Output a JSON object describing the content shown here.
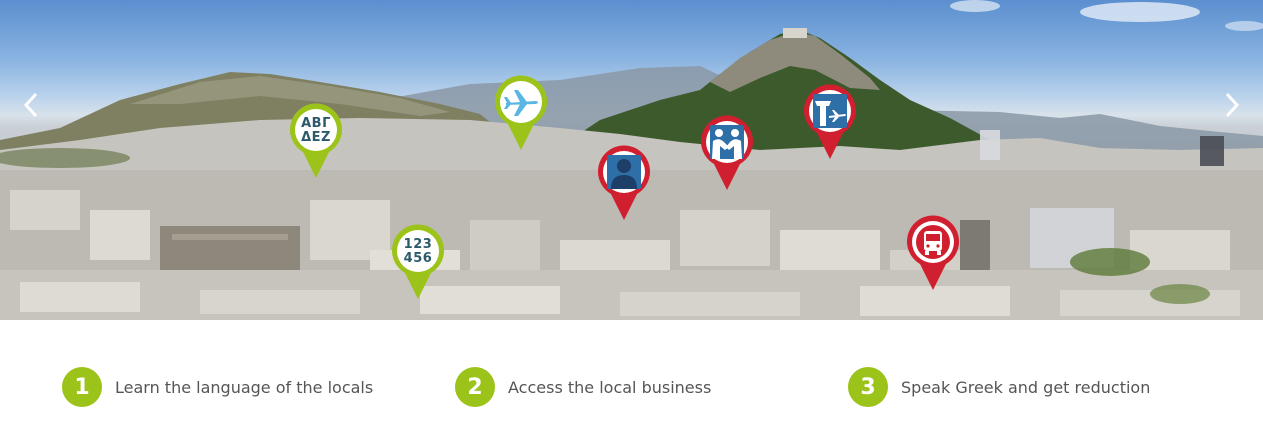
{
  "slider": {
    "prev_icon": "chevron-left-icon",
    "next_icon": "chevron-right-icon",
    "pins": [
      {
        "name": "greek-alphabet",
        "color": "#9cc31a",
        "line1": "ΑΒΓ",
        "line2": "ΔΕΖ"
      },
      {
        "name": "airplane",
        "color": "#9cc31a",
        "icon": "airplane-icon"
      },
      {
        "name": "greek-numbers",
        "color": "#9cc31a",
        "line1": "123",
        "line2": "456"
      },
      {
        "name": "person",
        "color": "#d01f2f",
        "icon": "person-icon"
      },
      {
        "name": "handshake",
        "color": "#d01f2f",
        "icon": "handshake-icon"
      },
      {
        "name": "airport-tower",
        "color": "#d01f2f",
        "icon": "airport-tower-icon"
      },
      {
        "name": "bus",
        "color": "#d01f2f",
        "icon": "bus-icon"
      }
    ]
  },
  "features": [
    {
      "number": "1",
      "label": "Learn the language of the locals"
    },
    {
      "number": "2",
      "label": "Access the local business"
    },
    {
      "number": "3",
      "label": "Speak Greek and get reduction"
    }
  ],
  "colors": {
    "accent_green": "#9cc31a",
    "accent_red": "#d01f2f",
    "text_gray": "#555555",
    "icon_blue": "#2f6fa8"
  }
}
